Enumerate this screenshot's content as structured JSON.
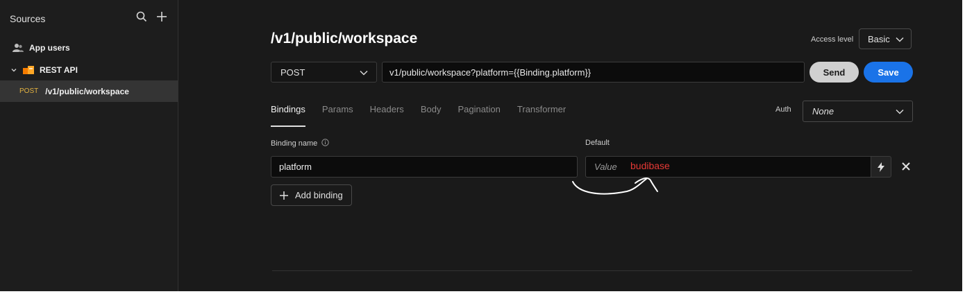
{
  "sidebar": {
    "title": "Sources",
    "items": [
      {
        "label": "App users",
        "icon": "users-icon"
      },
      {
        "label": "REST API",
        "icon": "rest-api-icon",
        "expanded": true
      },
      {
        "method": "POST",
        "label": "/v1/public/workspace",
        "selected": true
      }
    ]
  },
  "header": {
    "title": "/v1/public/workspace",
    "access_level_label": "Access level",
    "access_level_value": "Basic"
  },
  "request": {
    "method": "POST",
    "url": "v1/public/workspace?platform={{Binding.platform}}",
    "send_label": "Send",
    "save_label": "Save"
  },
  "tabs": [
    "Bindings",
    "Params",
    "Headers",
    "Body",
    "Pagination",
    "Transformer"
  ],
  "active_tab": "Bindings",
  "auth": {
    "label": "Auth",
    "value": "None"
  },
  "bindings": {
    "name_label": "Binding name",
    "default_label": "Default",
    "rows": [
      {
        "name": "platform",
        "default_placeholder": "Value"
      }
    ],
    "add_label": "Add binding"
  },
  "annotation": {
    "text": "budibase",
    "color": "#e53935"
  },
  "colors": {
    "accent": "#1a73e8",
    "post_method": "#e3b341",
    "background": "#1a1a1a"
  }
}
